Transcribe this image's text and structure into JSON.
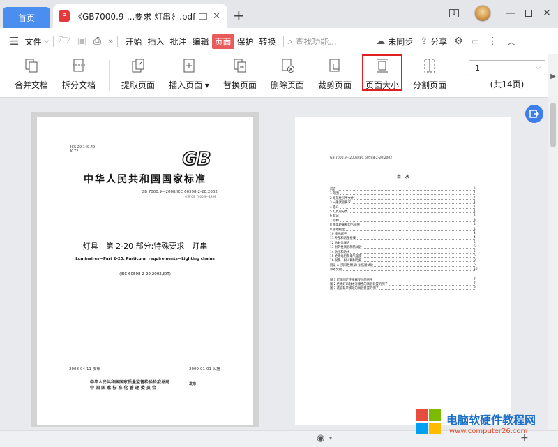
{
  "tabs": {
    "home": "首页",
    "doc_title": "《GB7000.9-...要求 灯串》.pdf",
    "pdf_badge": "P"
  },
  "window": {
    "badge": "1"
  },
  "menu": {
    "file": "文件",
    "items": [
      "开始",
      "插入",
      "批注",
      "编辑",
      "页面",
      "保护",
      "转换"
    ],
    "search_placeholder": "查找功能...",
    "sync": "未同步",
    "share": "分享"
  },
  "toolbar": {
    "merge": "合并文档",
    "split_doc": "拆分文档",
    "extract": "提取页面",
    "insert": "插入页面",
    "replace": "替换页面",
    "delete": "删除页面",
    "crop": "裁剪页面",
    "page_size": "页面大小",
    "split_page": "分割页面"
  },
  "page_nav": {
    "current": "1",
    "total": "(共14页)"
  },
  "page1": {
    "ics": "ICS 29.140.40",
    "k": "K 72",
    "gb_logo": "GB",
    "national_title": "中华人民共和国国家标准",
    "std_no": "GB 7000.9—2008/IEC 60598-2-20:2002",
    "replaces": "代替 GB 7000.9—1999",
    "cn_title": "灯具　第 2-20 部分:特殊要求　灯串",
    "en_title": "Luminaires—Part 2-20: Particular requirements—Lighting chains",
    "idt": "(IEC 60598-2-20:2002,IDT)",
    "issued": "2008-04-11 发布",
    "effective": "2009-01-01 实施",
    "issuer1": "中华人民共和国国家质量监督检验检疫总局",
    "issuer2": "中 国 国 家 标 准 化 管 理 委 员 会",
    "issue_word": "发布"
  },
  "page2": {
    "header": "GB 7000.9—2008/IEC 60598-2-20:2002",
    "toc_title": "目　次",
    "toc": [
      {
        "l": "前言",
        "n": "II"
      },
      {
        "l": "1  范围",
        "n": "1"
      },
      {
        "l": "2  规范性引用文件",
        "n": "1"
      },
      {
        "l": "3  一般试验要求",
        "n": "1"
      },
      {
        "l": "4  定义",
        "n": "1"
      },
      {
        "l": "5  灯具的分类",
        "n": "2"
      },
      {
        "l": "6  标记",
        "n": "2"
      },
      {
        "l": "7  结构",
        "n": "3"
      },
      {
        "l": "8  爬电距离和电气间隙",
        "n": "4"
      },
      {
        "l": "9  接地规定",
        "n": "4"
      },
      {
        "l": "10  接线端子",
        "n": "4"
      },
      {
        "l": "11  外部和内部接线",
        "n": "4"
      },
      {
        "l": "12  防触电保护",
        "n": "5"
      },
      {
        "l": "13  耐久性试验和热试验",
        "n": "5"
      },
      {
        "l": "14  防尘和防水",
        "n": "5"
      },
      {
        "l": "15  绝缘电阻和电气强度",
        "n": "5"
      },
      {
        "l": "16  耐热、耐火和耐电痕",
        "n": "6"
      },
      {
        "l": "附录 A (资料性附录)  耐低温试验",
        "n": "6"
      },
      {
        "l": "参考文献",
        "n": "10"
      }
    ],
    "figs": [
      {
        "l": "图 1  灯串固定连接器受拉的例子",
        "n": "7"
      },
      {
        "l": "图 2  绝缘灯串融才对擦性的试验装置的例子",
        "n": "7"
      },
      {
        "l": "图 3  适宜轨带横段的试验装置的例子",
        "n": "8"
      }
    ]
  },
  "watermark": {
    "name": "电脑软硬件教程网",
    "url": "www.computer26.com"
  },
  "colors": {
    "accent": "#4a8ef0",
    "highlight": "#e02020",
    "active_menu": "#e85b5b"
  }
}
